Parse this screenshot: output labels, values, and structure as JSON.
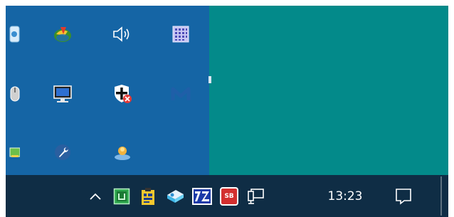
{
  "taskbar": {
    "show_hidden_label": "^",
    "clock": "13:23",
    "notification_sb_label": "SB",
    "notification_7z_label": "7Z"
  }
}
